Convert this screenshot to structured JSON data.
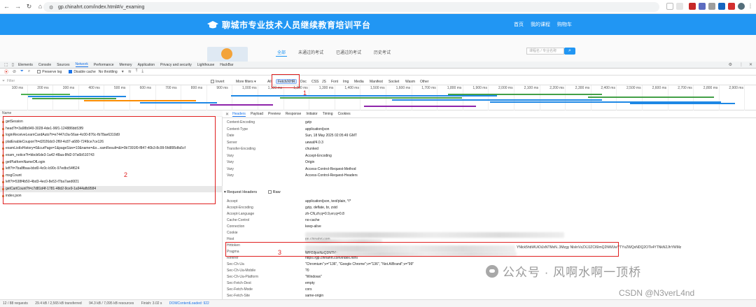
{
  "browser": {
    "url": "gp.chinahrt.com/index.html#/v_examing",
    "nav_icons": [
      "back-icon",
      "forward-icon",
      "reload-icon",
      "home-icon"
    ]
  },
  "site": {
    "title": "聊城市专业技术人员继续教育培训平台",
    "nav": [
      "首页",
      "我的课程",
      "购物车"
    ],
    "tabs": [
      "全部",
      "未通过的考试",
      "已通过的考试",
      "历史考试"
    ],
    "search_placeholder": "课程名 / 专业名称"
  },
  "devtools": {
    "panels": [
      "Elements",
      "Console",
      "Sources",
      "Network",
      "Performance",
      "Memory",
      "Application",
      "Privacy and security",
      "Lighthouse",
      "HackBar"
    ],
    "active_panel": "Network",
    "toolbar": {
      "preserve_log": "Preserve log",
      "disable_cache": "Disable cache",
      "throttling": "No throttling"
    },
    "filter": {
      "placeholder": "Filter",
      "invert": "Invert",
      "more_filters": "More filters",
      "types": [
        "All",
        "Fetch/XHR",
        "Doc",
        "CSS",
        "JS",
        "Font",
        "Img",
        "Media",
        "Manifest",
        "Socket",
        "Wasm",
        "Other"
      ],
      "active_type": "Fetch/XHR"
    },
    "timeline_ticks": [
      "100 ms",
      "200 ms",
      "300 ms",
      "400 ms",
      "500 ms",
      "600 ms",
      "700 ms",
      "800 ms",
      "900 ms",
      "1,000 ms",
      "1,100 ms",
      "1,200 ms",
      "1,300 ms",
      "1,400 ms",
      "1,500 ms",
      "1,600 ms",
      "1,700 ms",
      "1,800 ms",
      "1,900 ms",
      "2,000 ms",
      "2,100 ms",
      "2,200 ms",
      "2,300 ms",
      "2,400 ms",
      "2,500 ms",
      "2,600 ms",
      "2,700 ms",
      "2,800 ms",
      "2,900 ms"
    ],
    "requests_header": "Name",
    "requests": [
      "getSession",
      "head?t=3a98b949-3028-4de1-96f1-124886bb53f9",
      "loginReceiveLearnCardAuto?t=e7447c0a-56ae-4c00-876c-fb78ae6310d9",
      "platEnableCoupon?t=d2026dc0-2f6f-4c87-a680-7249ce7ce126",
      "examListIsHistory=0&curPage=1&pageSize=10&name=&o...xamResult=&t=0b7391f0-f847-40b3-8c99-5fd895dfa5cf",
      "exam_notice?t=bbcb6de3-1a42-48aa-8fd2-97a6b510743",
      "getPlatformNameOfLogin",
      "left?t=7ba8fbaa-bbd0-4c0c-b90c-97edbc54f624",
      "msgCount",
      "left?t=538f4b50-4bd3-4ec0-8e53-f7ba7aed6f21",
      "getCartCount?t=c7d81d4f-1781-48d2-9ce9-1a944afb9584",
      "index.json"
    ],
    "selected_request": 10,
    "detail_tabs": [
      "Headers",
      "Payload",
      "Preview",
      "Response",
      "Initiator",
      "Timing",
      "Cookies"
    ],
    "active_detail_tab": "Headers",
    "response_headers": [
      {
        "k": "Content-Encoding",
        "v": "gzip"
      },
      {
        "k": "Content-Type",
        "v": "application/json"
      },
      {
        "k": "Date",
        "v": "Sun, 18 May 2025 02:05:49 GMT"
      },
      {
        "k": "Server",
        "v": "uewaf/4.0.3"
      },
      {
        "k": "Transfer-Encoding",
        "v": "chunked"
      },
      {
        "k": "Vary",
        "v": "Accept-Encoding"
      },
      {
        "k": "Vary",
        "v": "Origin"
      },
      {
        "k": "Vary",
        "v": "Access-Control-Request-Method"
      },
      {
        "k": "Vary",
        "v": "Access-Control-Request-Headers"
      }
    ],
    "request_headers_title": "Request Headers",
    "raw_label": "Raw",
    "request_headers": [
      {
        "k": "Accept",
        "v": "application/json, text/plain, */*"
      },
      {
        "k": "Accept-Encoding",
        "v": "gzip, deflate, br, zstd"
      },
      {
        "k": "Accept-Language",
        "v": "zh-CN,zh;q=0.9,en;q=0.8"
      },
      {
        "k": "Cache-Control",
        "v": "no-cache"
      },
      {
        "k": "Connection",
        "v": "keep-alive"
      },
      {
        "k": "Cookie",
        "v": ""
      },
      {
        "k": "Host",
        "v": "gp.chinahrt.com"
      },
      {
        "k": "Hrttoken",
        "v": ""
      },
      {
        "k": "Pragma",
        "v": "no-cache"
      },
      {
        "k": "Referer",
        "v": "https://gp.chinahrt.com/index.html"
      },
      {
        "k": "Sec-Ch-Ua",
        "v": "\"Chromium\";v=\"136\", \"Google Chrome\";v=\"136\", \"Not.A/Brand\";v=\"99\""
      },
      {
        "k": "Sec-Ch-Ua-Mobile",
        "v": "?0"
      },
      {
        "k": "Sec-Ch-Ua-Platform",
        "v": "\"Windows\""
      },
      {
        "k": "Sec-Fetch-Dest",
        "v": "empty"
      },
      {
        "k": "Sec-Fetch-Mode",
        "v": "cors"
      },
      {
        "k": "Sec-Fetch-Site",
        "v": "same-origin"
      },
      {
        "k": "User-Agent",
        "v": "Mozilla/5.0 (Windows NT 10.0; Win64; x64) AppleWebKit/537.36 (KHTML, like Gecko) Chrome/136.0.0.0 Safari/537.36"
      }
    ],
    "hrttoken_fragments": [
      "YNlck5hbWUiOiJxNTMxN..3Mzgy NlsInVzZXJJZCI6ImQ2NWUwYTYxZWQxNDQ2OTk4YTNkN2JhYWMz",
      "WFOJjoxNzQ3NTMy"
    ],
    "status": {
      "requests": "12 / 88 requests",
      "transferred": "29.4 kB / 2,565 kB transferred",
      "resources": "94.3 kB / 7,095 kB resources",
      "finish": "Finish: 3.02 s",
      "dcl": "DOMContentLoaded: 922"
    }
  },
  "annotations": [
    "1",
    "2",
    "3"
  ],
  "watermark": {
    "line1": "公众号 · 风啊水啊一顶桥",
    "line2": "CSDN @N3verL4nd"
  },
  "colors": {
    "site_blue": "#2196f3",
    "devtools_blue": "#1a73e8",
    "annotation_red": "#e02020"
  }
}
